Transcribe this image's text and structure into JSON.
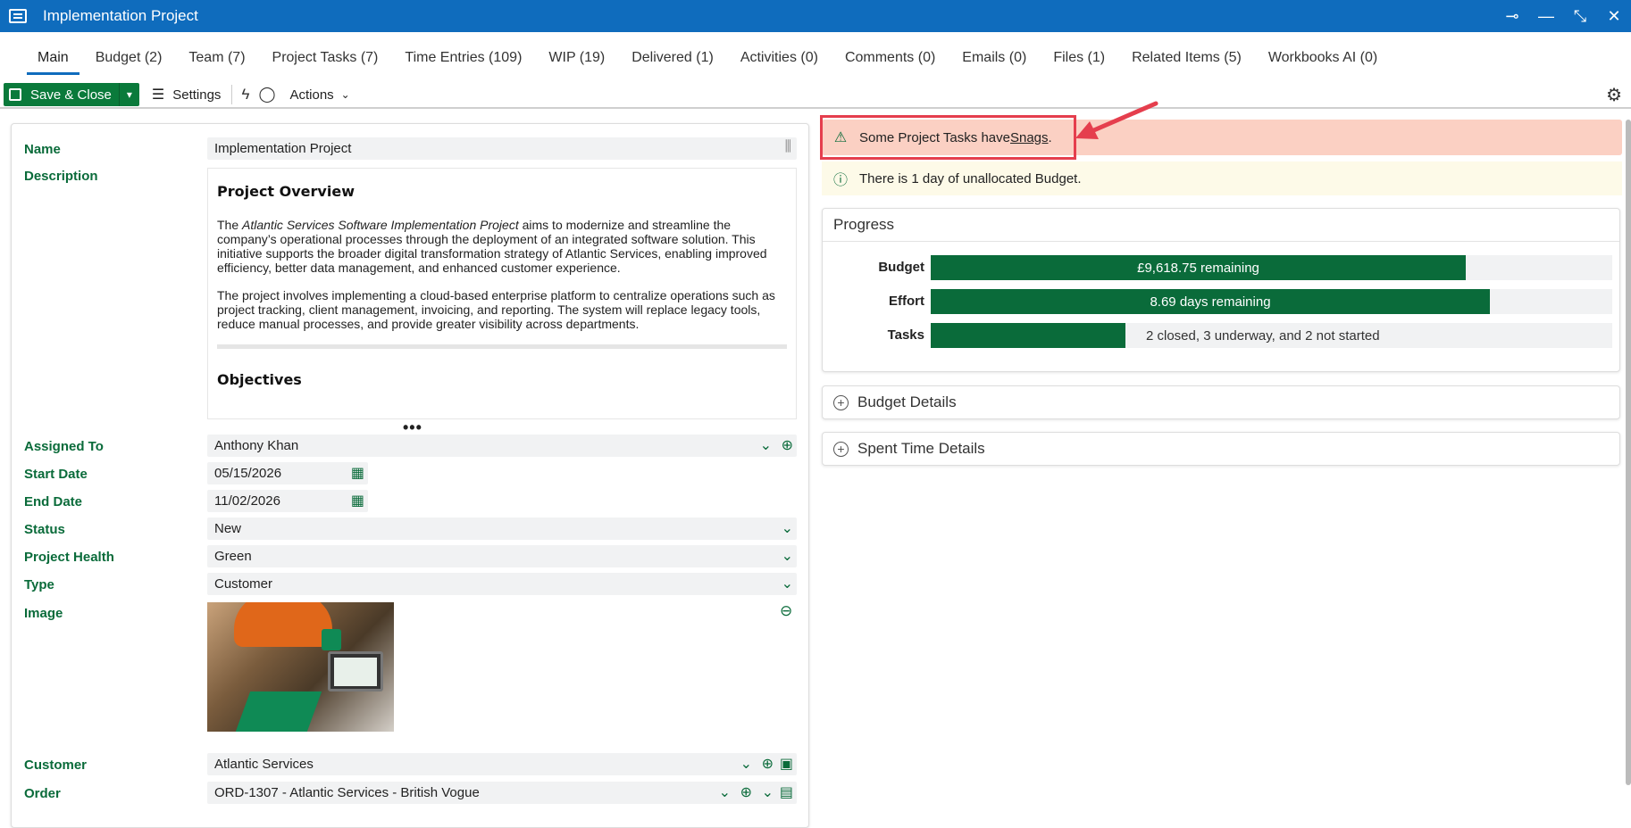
{
  "window": {
    "title": "Implementation Project"
  },
  "tabs": [
    {
      "label": "Main"
    },
    {
      "label": "Budget (2)"
    },
    {
      "label": "Team (7)"
    },
    {
      "label": "Project Tasks (7)"
    },
    {
      "label": "Time Entries (109)"
    },
    {
      "label": "WIP (19)"
    },
    {
      "label": "Delivered (1)"
    },
    {
      "label": "Activities (0)"
    },
    {
      "label": "Comments (0)"
    },
    {
      "label": "Emails (0)"
    },
    {
      "label": "Files (1)"
    },
    {
      "label": "Related Items (5)"
    },
    {
      "label": "Workbooks AI (0)"
    }
  ],
  "toolbar": {
    "save_label": "Save & Close",
    "settings_label": "Settings",
    "actions_label": "Actions"
  },
  "form": {
    "name_label": "Name",
    "name_value": "Implementation Project",
    "description_label": "Description",
    "description": {
      "heading": "Project Overview",
      "para1_pre": "The ",
      "para1_em": "Atlantic Services Software Implementation Project",
      "para1_post": " aims to modernize and streamline the company’s operational processes through the deployment of an integrated software solution. This initiative supports the broader digital transformation strategy of Atlantic Services, enabling improved efficiency, better data management, and enhanced customer experience.",
      "para2": "The project involves implementing a cloud-based enterprise platform to centralize operations such as project tracking, client management, invoicing, and reporting. The system will replace legacy tools, reduce manual processes, and provide greater visibility across departments.",
      "heading2": "Objectives"
    },
    "assigned_label": "Assigned To",
    "assigned_value": "Anthony Khan",
    "start_label": "Start Date",
    "start_value": "05/15/2026",
    "end_label": "End Date",
    "end_value": "11/02/2026",
    "status_label": "Status",
    "status_value": "New",
    "health_label": "Project Health",
    "health_value": "Green",
    "type_label": "Type",
    "type_value": "Customer",
    "image_label": "Image",
    "customer_label": "Customer",
    "customer_value": "Atlantic Services",
    "order_label": "Order",
    "order_value": "ORD-1307 - Atlantic Services - British Vogue"
  },
  "alerts": {
    "warning_pre": "Some Project Tasks have ",
    "warning_link": "Snags",
    "warning_post": ".",
    "info": "There is 1 day of unallocated Budget."
  },
  "progress": {
    "title": "Progress",
    "rows": [
      {
        "label": "Budget",
        "text": "£9,618.75 remaining",
        "fill": 0.785
      },
      {
        "label": "Effort",
        "text": "8.69 days remaining",
        "fill": 0.821
      },
      {
        "label": "Tasks",
        "text": "2 closed, 3 underway, and 2 not started",
        "fill": 0.286
      }
    ]
  },
  "sections": {
    "budget_details": "Budget Details",
    "spent_time_details": "Spent Time Details"
  },
  "colors": {
    "titlebar": "#0f6cbd",
    "accent_green": "#0a6b3a",
    "warning_bg": "#fbd0c3",
    "info_bg": "#fdfae8",
    "highlight": "#e53e4d"
  }
}
